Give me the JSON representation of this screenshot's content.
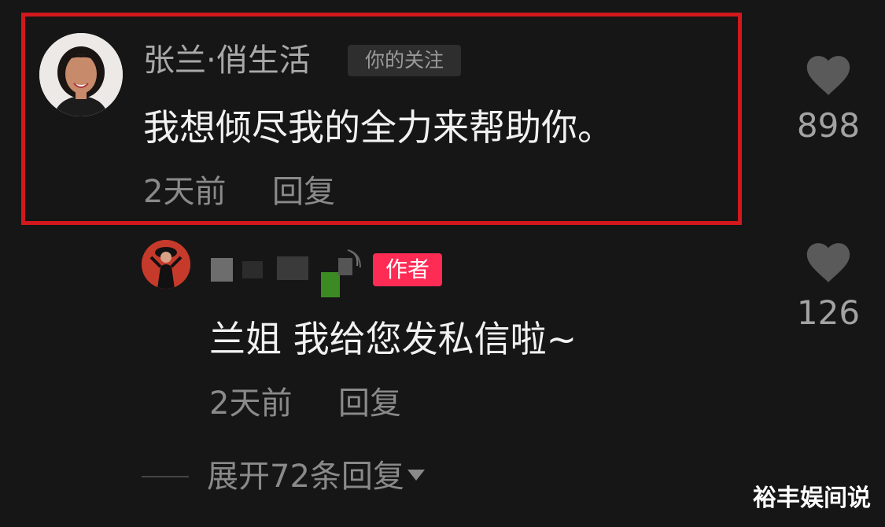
{
  "comments": [
    {
      "username": "张兰·俏生活",
      "follow_badge": "你的关注",
      "text": "我想倾尽我的全力来帮助你。",
      "time": "2天前",
      "reply_label": "回复",
      "like_count": "898"
    },
    {
      "author_badge": "作者",
      "text": "兰姐 我给您发私信啦~",
      "time": "2天前",
      "reply_label": "回复",
      "like_count": "126"
    }
  ],
  "expand_replies": "展开72条回复",
  "watermark": "裕丰娱间说",
  "colors": {
    "highlight": "#d1181c",
    "author_badge": "#fe2c55",
    "background": "#161616"
  },
  "icons": {
    "like": "heart-icon",
    "expand": "chevron-down-icon"
  }
}
